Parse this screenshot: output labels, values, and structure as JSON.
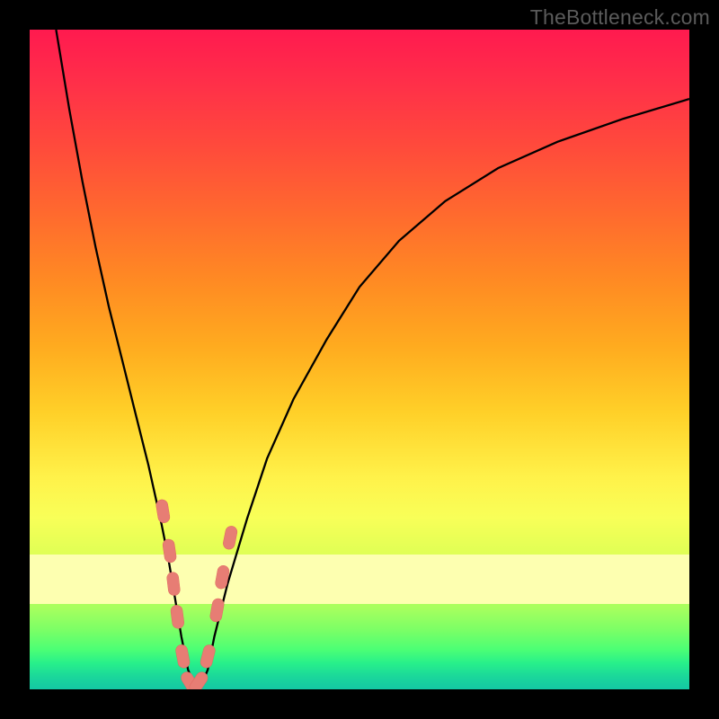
{
  "watermark": {
    "text": "TheBottleneck.com"
  },
  "colors": {
    "background": "#000000",
    "curve_stroke": "#000000",
    "marker_fill": "#e77d74",
    "marker_stroke": "#e0685f"
  },
  "chart_data": {
    "type": "line",
    "title": "",
    "xlabel": "",
    "ylabel": "",
    "xlim": [
      0,
      100
    ],
    "ylim": [
      0,
      100
    ],
    "grid": false,
    "legend": null,
    "series": [
      {
        "name": "bottleneck-curve",
        "x": [
          4,
          6,
          8,
          10,
          12,
          14,
          16,
          18,
          20,
          21,
          22,
          23,
          24,
          25,
          26,
          27,
          28,
          30,
          33,
          36,
          40,
          45,
          50,
          56,
          63,
          71,
          80,
          90,
          100
        ],
        "y": [
          100,
          88,
          77,
          67,
          58,
          50,
          42,
          34,
          25,
          20,
          14,
          8,
          3,
          0.5,
          0.5,
          3,
          8,
          16,
          26,
          35,
          44,
          53,
          61,
          68,
          74,
          79,
          83,
          86.5,
          89.5
        ]
      }
    ],
    "markers": [
      {
        "x": 20.2,
        "y": 27
      },
      {
        "x": 21.2,
        "y": 21
      },
      {
        "x": 21.8,
        "y": 16
      },
      {
        "x": 22.4,
        "y": 11
      },
      {
        "x": 23.2,
        "y": 5
      },
      {
        "x": 24.3,
        "y": 1
      },
      {
        "x": 25.6,
        "y": 1
      },
      {
        "x": 27.0,
        "y": 5
      },
      {
        "x": 28.4,
        "y": 12
      },
      {
        "x": 29.2,
        "y": 17
      },
      {
        "x": 30.4,
        "y": 23
      }
    ]
  }
}
